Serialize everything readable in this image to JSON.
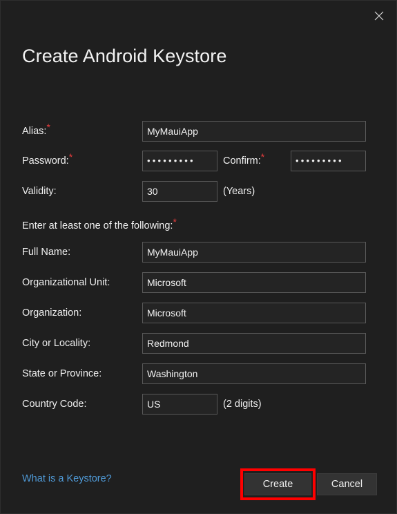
{
  "dialog": {
    "title": "Create Android Keystore",
    "close_icon": "close-icon"
  },
  "form": {
    "section_note": "Enter at least one of the following:",
    "required_marker": "*",
    "rows": {
      "alias": {
        "label": "Alias:",
        "value": "MyMauiApp",
        "required": true
      },
      "password": {
        "label": "Password:",
        "value": "•••••••••",
        "required": true
      },
      "confirm": {
        "label": "Confirm:",
        "value": "•••••••••",
        "required": true
      },
      "validity": {
        "label": "Validity:",
        "value": "30",
        "suffix": "(Years)",
        "required": false
      },
      "full_name": {
        "label": "Full Name:",
        "value": "MyMauiApp",
        "required": false
      },
      "organizational_unit": {
        "label": "Organizational Unit:",
        "value": "Microsoft",
        "required": false
      },
      "organization": {
        "label": "Organization:",
        "value": "Microsoft",
        "required": false
      },
      "city": {
        "label": "City or Locality:",
        "value": "Redmond",
        "required": false
      },
      "state": {
        "label": "State or Province:",
        "value": "Washington",
        "required": false
      },
      "country_code": {
        "label": "Country Code:",
        "value": "US",
        "suffix": "(2 digits)",
        "required": false
      }
    }
  },
  "footer": {
    "help_link": "What is a Keystore?",
    "create_label": "Create",
    "cancel_label": "Cancel"
  },
  "colors": {
    "dialog_background": "#1f1f1f",
    "field_background": "#242424",
    "field_border": "#585858",
    "text": "#f2f2f2",
    "required_asterisk": "#e63c3c",
    "link": "#4f9ad7",
    "button_background": "#333333",
    "highlight_box": "#ff0000"
  }
}
